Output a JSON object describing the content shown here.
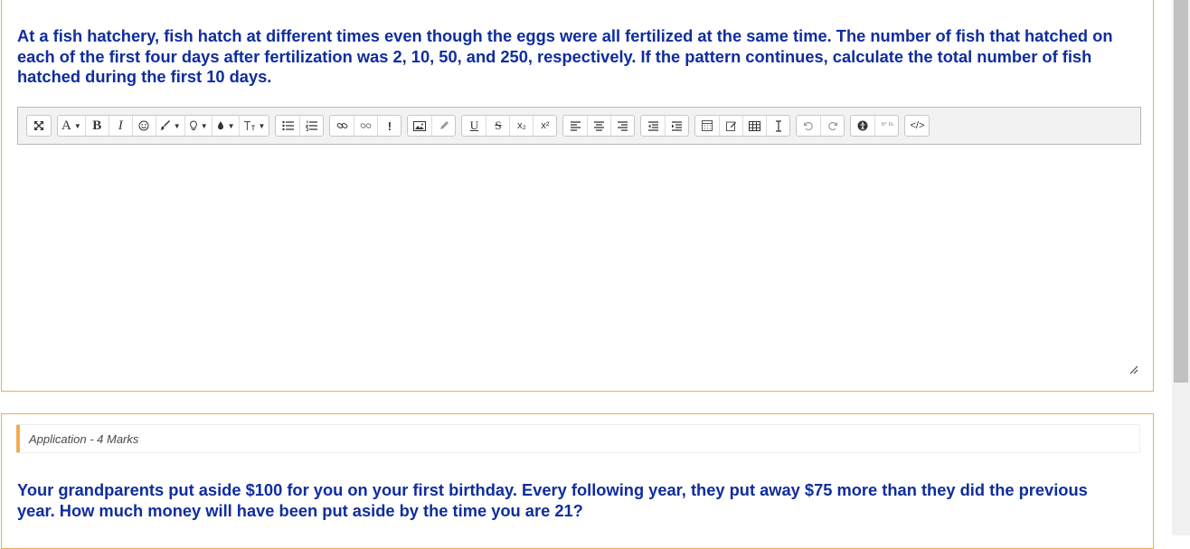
{
  "question1": {
    "text": "At a fish hatchery, fish hatch at different times even though the eggs were all fertilized at the same time. The number of fish that hatched on each of the first four days after fertilization was 2, 10, 50, and 250, respectively. If the pattern continues, calculate the total number of fish hatched during the first 10 days."
  },
  "toolbar": {
    "bold": "B",
    "italic": "I",
    "font_color": "A",
    "underline": "U",
    "strike": "S",
    "subscript": "x₂",
    "superscript": "x²",
    "important": "!",
    "html": "</>"
  },
  "question2": {
    "tag": "Application - 4 Marks",
    "text": "Your grandparents put aside $100 for you on your first birthday. Every following year, they put away $75 more than they did the previous year. How much money will have been put aside by the time you are 21?"
  },
  "colors": {
    "question_text": "#0f2d9e",
    "panel_border": "#f0ad4e"
  }
}
